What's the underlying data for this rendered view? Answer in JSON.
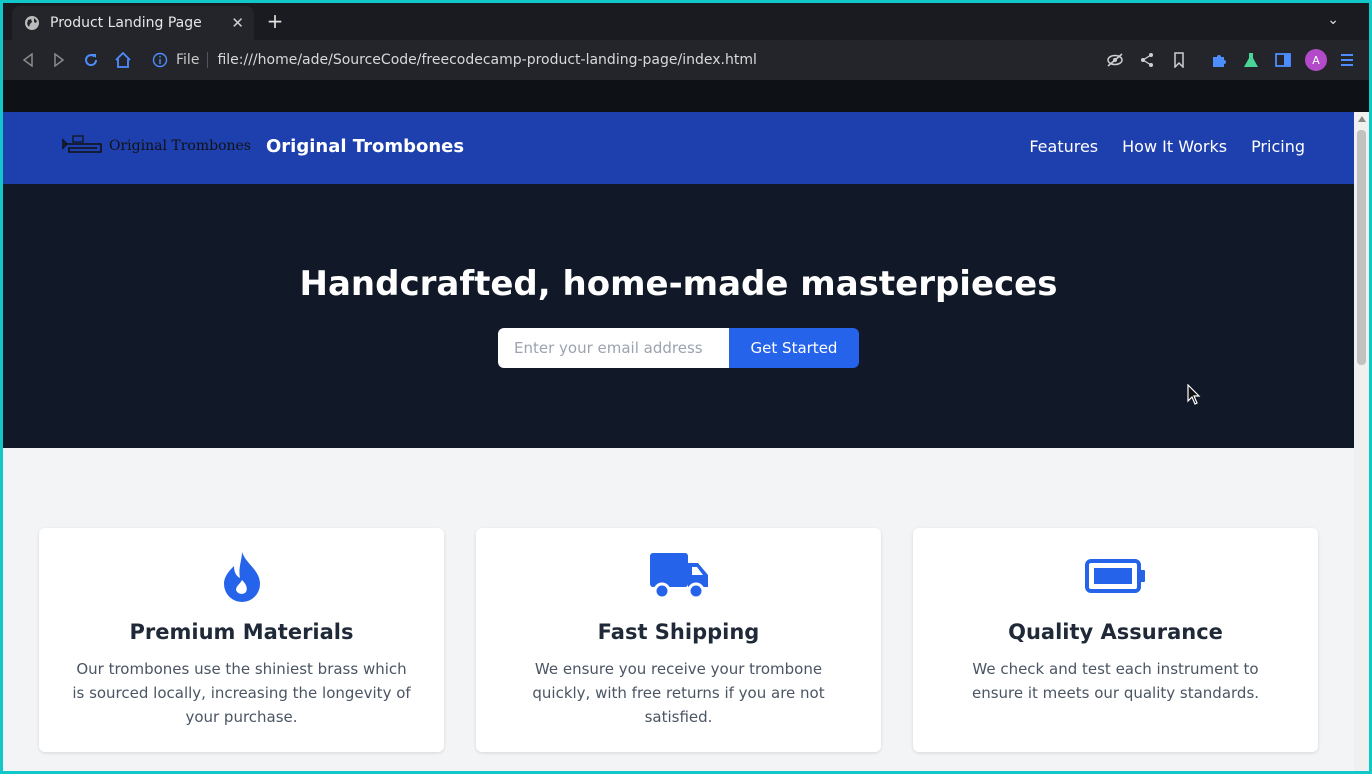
{
  "browser": {
    "tab_title": "Product Landing Page",
    "url_scheme": "File",
    "url": "file:///home/ade/SourceCode/freecodecamp-product-landing-page/index.html",
    "profile_initial": "A",
    "accent_color": "#12c7c7"
  },
  "header": {
    "logo_text": "Original Trombones",
    "brand": "Original Trombones",
    "nav": [
      "Features",
      "How It Works",
      "Pricing"
    ],
    "color": "#1e40af"
  },
  "hero": {
    "heading": "Handcrafted, home-made masterpieces",
    "email_placeholder": "Enter your email address",
    "cta": "Get Started",
    "background": "#111827"
  },
  "features": [
    {
      "icon": "fire-icon",
      "title": "Premium Materials",
      "text": "Our trombones use the shiniest brass which is sourced locally, increasing the longevity of your purchase."
    },
    {
      "icon": "truck-icon",
      "title": "Fast Shipping",
      "text": "We ensure you receive your trombone quickly, with free returns if you are not satisfied."
    },
    {
      "icon": "battery-icon",
      "title": "Quality Assurance",
      "text": "We check and test each instrument to ensure it meets our quality standards."
    }
  ]
}
